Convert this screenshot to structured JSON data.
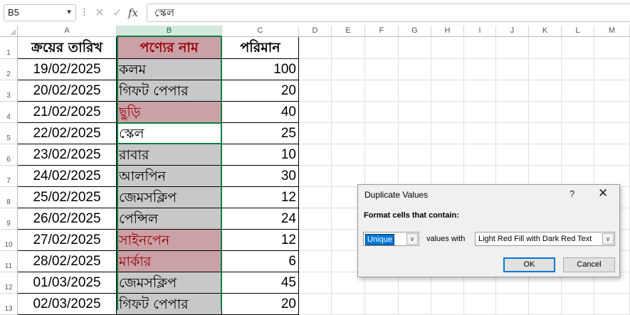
{
  "formula_bar": {
    "name_box": "B5",
    "more_icon": "kebab-vertical-icon",
    "cancel_icon": "x-icon",
    "enter_icon": "check-icon",
    "fx_label": "fx",
    "formula_value": "স্কেল"
  },
  "columns": [
    "A",
    "B",
    "C",
    "D",
    "E",
    "F",
    "G",
    "H",
    "I",
    "J",
    "K",
    "L",
    "M"
  ],
  "row_numbers": [
    "1",
    "2",
    "3",
    "4",
    "5",
    "6",
    "7",
    "8",
    "9",
    "10",
    "11",
    "12",
    "13"
  ],
  "headers": {
    "a": "ক্রয়ের তারিখ",
    "b": "পণ্যের নাম",
    "c": "পরিমান"
  },
  "rows": [
    {
      "date": "19/02/2025",
      "product": "কলম",
      "qty": "100",
      "highlight": "gray"
    },
    {
      "date": "20/02/2025",
      "product": "গিফট পেপার",
      "qty": "20",
      "highlight": "gray"
    },
    {
      "date": "21/02/2025",
      "product": "ছুড়ি",
      "qty": "40",
      "highlight": "red"
    },
    {
      "date": "22/02/2025",
      "product": "স্কেল",
      "qty": "25",
      "highlight": "none"
    },
    {
      "date": "23/02/2025",
      "product": "রাবার",
      "qty": "10",
      "highlight": "gray"
    },
    {
      "date": "24/02/2025",
      "product": "আলপিন",
      "qty": "30",
      "highlight": "gray"
    },
    {
      "date": "25/02/2025",
      "product": "জেমসক্লিপ",
      "qty": "12",
      "highlight": "gray"
    },
    {
      "date": "26/02/2025",
      "product": "পেন্সিল",
      "qty": "24",
      "highlight": "gray"
    },
    {
      "date": "27/02/2025",
      "product": "সাইনপেন",
      "qty": "12",
      "highlight": "red"
    },
    {
      "date": "28/02/2025",
      "product": "মার্কার",
      "qty": "6",
      "highlight": "red"
    },
    {
      "date": "01/03/2025",
      "product": "জেমসক্লিপ",
      "qty": "45",
      "highlight": "gray"
    },
    {
      "date": "02/03/2025",
      "product": "গিফট পেপার",
      "qty": "20",
      "highlight": "gray"
    }
  ],
  "colors": {
    "gray_fill": "#c8c8c8",
    "light_red_fill": "#c9a1a6",
    "dark_red_text": "#9c0006",
    "selection_green": "#107c41"
  },
  "dialog": {
    "title": "Duplicate Values",
    "help": "?",
    "close": "✕",
    "prompt": "Format cells that contain:",
    "type_value": "Unique",
    "middle_text": "values with",
    "format_value": "Light Red Fill with Dark Red Text",
    "ok": "OK",
    "cancel": "Cancel"
  }
}
